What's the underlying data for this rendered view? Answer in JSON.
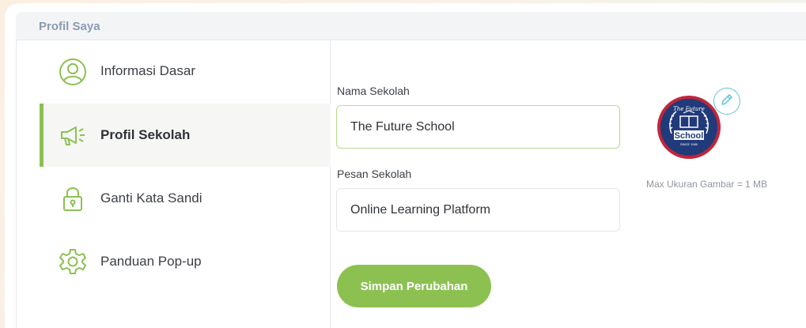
{
  "page": {
    "title": "Profil Saya"
  },
  "sidebar": {
    "items": [
      {
        "label": "Informasi Dasar",
        "icon": "user-circle-icon",
        "active": false
      },
      {
        "label": "Profil Sekolah",
        "icon": "megaphone-icon",
        "active": true
      },
      {
        "label": "Ganti Kata Sandi",
        "icon": "lock-icon",
        "active": false
      },
      {
        "label": "Panduan Pop-up",
        "icon": "gear-icon",
        "active": false
      }
    ]
  },
  "form": {
    "school_name": {
      "label": "Nama Sekolah",
      "value": "The Future School"
    },
    "school_message": {
      "label": "Pesan Sekolah",
      "value": "Online Learning Platform"
    },
    "save_label": "Simpan Perubahan"
  },
  "logo": {
    "top_text": "The Future",
    "main_text": "School",
    "bottom_text": "SINCE 1980",
    "max_size_note": "Max Ukuran Gambar = 1 MB"
  },
  "colors": {
    "accent": "#8cc152",
    "title": "#8b9bb2",
    "logo_navy": "#213a7a",
    "logo_red": "#c1263a",
    "edit_cyan": "#5cc6d6"
  }
}
